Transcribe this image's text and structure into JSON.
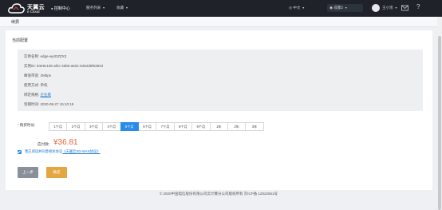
{
  "header": {
    "logo_cn": "天翼云",
    "logo_en": "e Cloud",
    "console": "控制中心",
    "nav": [
      {
        "label": "服务列表"
      },
      {
        "label": "收藏"
      }
    ],
    "language": "中文",
    "region": "成都2",
    "user": "王小凯",
    "help": "?"
  },
  "page": {
    "title": "续费",
    "section_title": "当前配置"
  },
  "info": {
    "rows": [
      {
        "label": "实例名称",
        "value": "edge-wyIGZZX2"
      },
      {
        "label": "实例ID",
        "value": "94e9c135-af4c-4d66-a631-6462d6f63843"
      },
      {
        "label": "峰值带宽",
        "value": "2Mbps"
      },
      {
        "label": "使用方式",
        "value": "单机"
      },
      {
        "label": "绑定规格",
        "value": "企业版"
      },
      {
        "label": "到期时间",
        "value": "2020-08-27 15:10:19"
      }
    ]
  },
  "duration": {
    "label": "购买时长:",
    "options": [
      "1个月",
      "2个月",
      "3个月",
      "4个月",
      "5个月",
      "6个月",
      "7个月",
      "8个月",
      "9个月",
      "1年",
      "2年",
      "3年"
    ],
    "selected_index": 4
  },
  "price": {
    "label": "应付款:",
    "value": "¥36.81"
  },
  "agreement": {
    "text": "我已阅读并同意相关协议",
    "link": "《天翼云SD-WAN协议》"
  },
  "buttons": {
    "prev": "上一步",
    "confirm": "确定"
  },
  "footer": {
    "text": "© 2020中国电信股份有限公司云计算分公司版权所有 京ICP备 12022551号"
  },
  "colors": {
    "topbar": "#1f2329",
    "accent": "#2a8cea",
    "price": "#e8663b",
    "confirm": "#e4a640"
  }
}
